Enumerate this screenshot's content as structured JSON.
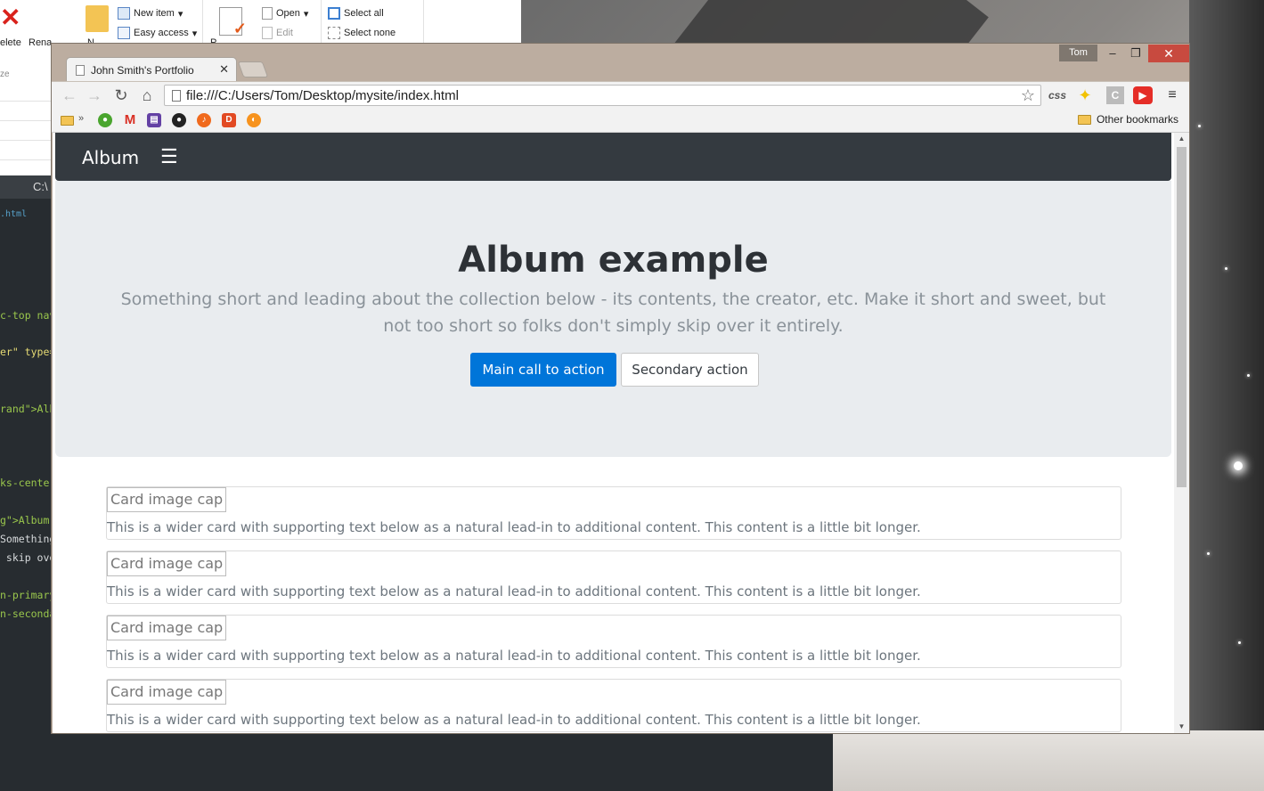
{
  "explorer": {
    "delete_label": "elete",
    "rename_label": "Rena",
    "new_item": "New item",
    "easy_access": "Easy access",
    "open": "Open",
    "edit": "Edit",
    "select_all": "Select all",
    "select_none": "Select none",
    "new_label": "N",
    "props_label": "P",
    "size_label": "ze"
  },
  "editor": {
    "tab_label": "C:\\",
    "file_label": ".html",
    "lines": [
      {
        "text": "c-top nav",
        "cls": "c-attr"
      },
      {
        "text": "er\" type=",
        "cls": "c-str"
      },
      {
        "text": "rand\">Alb",
        "cls": "c-attr"
      },
      {
        "text": "ks-center",
        "cls": "c-attr"
      },
      {
        "text": "g\">Album",
        "cls": "c-attr"
      },
      {
        "text": "Something",
        "cls": ""
      },
      {
        "text": " skip ove",
        "cls": ""
      },
      {
        "text": "n-primary",
        "cls": "c-attr"
      },
      {
        "text": "n-seconda",
        "cls": "c-attr"
      }
    ]
  },
  "chrome": {
    "user": "Tom",
    "tab_title": "John Smith's Portfolio",
    "url": "file:///C:/Users/Tom/Desktop/mysite/index.html",
    "css_ext": "css",
    "other_bookmarks": "Other bookmarks"
  },
  "page": {
    "brand": "Album",
    "toggler": "☰",
    "jumbo_title": "Album example",
    "jumbo_lead": "Something short and leading about the collection below - its contents, the creator, etc. Make it short and sweet, but not too short so folks don't simply skip over it entirely.",
    "primary_action": "Main call to action",
    "secondary_action": "Secondary action",
    "cards": [
      {
        "img": "Card image cap",
        "text": "This is a wider card with supporting text below as a natural lead-in to additional content. This content is a little bit longer."
      },
      {
        "img": "Card image cap",
        "text": "This is a wider card with supporting text below as a natural lead-in to additional content. This content is a little bit longer."
      },
      {
        "img": "Card image cap",
        "text": "This is a wider card with supporting text below as a natural lead-in to additional content. This content is a little bit longer."
      },
      {
        "img": "Card image cap",
        "text": "This is a wider card with supporting text below as a natural lead-in to additional content. This content is a little bit longer."
      }
    ]
  },
  "colors": {
    "navbar": "#343a40",
    "jumbotron": "#e9ecef",
    "primary": "#0075d9",
    "close_button": "#c84a3f"
  }
}
